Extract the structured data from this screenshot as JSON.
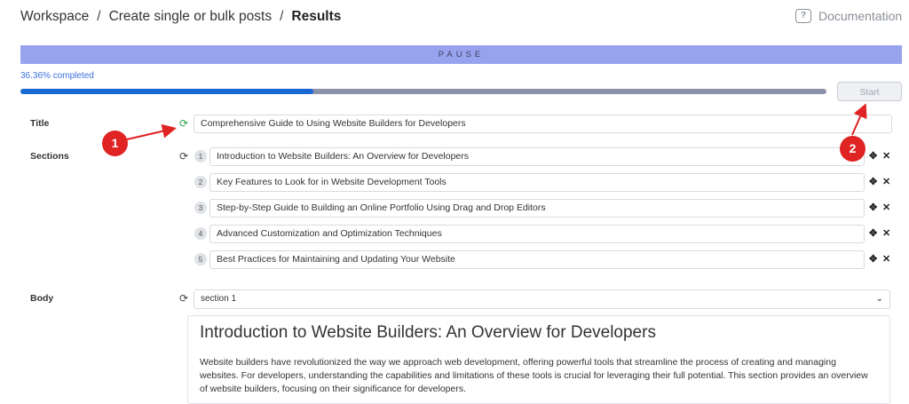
{
  "breadcrumb": {
    "items": [
      "Workspace",
      "Create single or bulk posts",
      "Results"
    ],
    "separator": "/"
  },
  "documentation": {
    "label": "Documentation",
    "icon": "chat-question-icon"
  },
  "pause": {
    "label": "PAUSE"
  },
  "progress": {
    "label": "36.36% completed",
    "value_percent": 36.36
  },
  "start_button": {
    "label": "Start"
  },
  "title_row": {
    "label": "Title",
    "value": "Comprehensive Guide to Using Website Builders for Developers"
  },
  "sections": {
    "label": "Sections",
    "items": [
      {
        "num": "1",
        "text": "Introduction to Website Builders: An Overview for Developers"
      },
      {
        "num": "2",
        "text": "Key Features to Look for in Website Development Tools"
      },
      {
        "num": "3",
        "text": "Step-by-Step Guide to Building an Online Portfolio Using Drag and Drop Editors"
      },
      {
        "num": "4",
        "text": "Advanced Customization and Optimization Techniques"
      },
      {
        "num": "5",
        "text": "Best Practices for Maintaining and Updating Your Website"
      }
    ]
  },
  "body_row": {
    "label": "Body",
    "select_value": "section 1",
    "heading": "Introduction to Website Builders: An Overview for Developers",
    "paragraph": "Website builders have revolutionized the way we approach web development, offering powerful tools that streamline the process of creating and managing websites. For developers, understanding the capabilities and limitations of these tools is crucial for leveraging their full potential. This section provides an overview of website builders, focusing on their significance for developers."
  },
  "annotations": {
    "badge1": "1",
    "badge2": "2",
    "color": "#e02323"
  },
  "colors": {
    "pause_bg": "#98a3ee",
    "progress_fill": "#1a68d6",
    "refresh_active": "#2ea84f"
  }
}
